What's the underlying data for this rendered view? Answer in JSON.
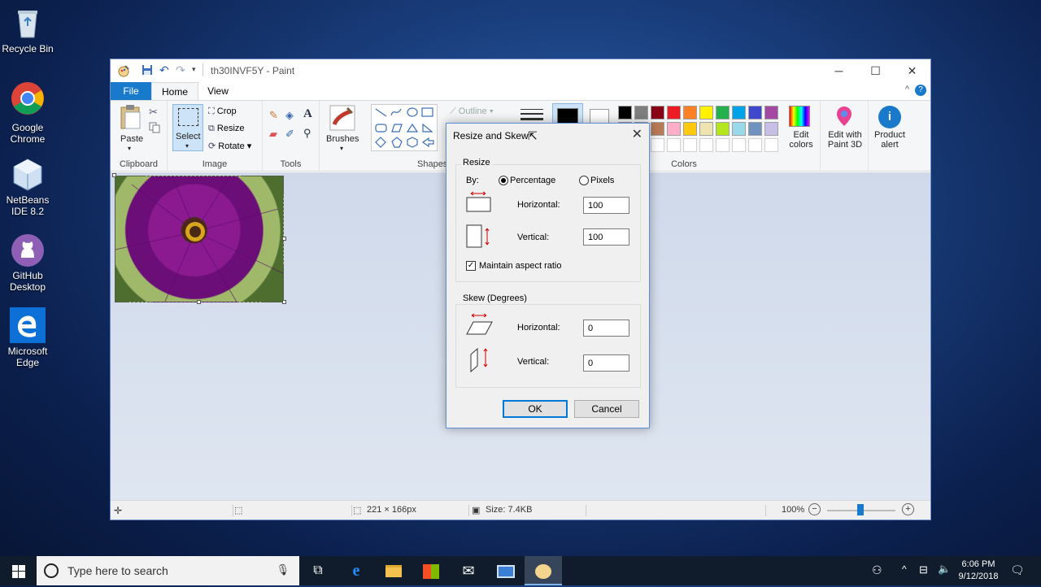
{
  "desktop": {
    "icons": [
      {
        "label": "Recycle Bin",
        "icon": "recycle-bin-icon"
      },
      {
        "label": "Google Chrome",
        "icon": "chrome-icon"
      },
      {
        "label": "NetBeans IDE 8.2",
        "icon": "netbeans-icon"
      },
      {
        "label": "GitHub Desktop",
        "icon": "github-icon"
      },
      {
        "label": "Microsoft Edge",
        "icon": "edge-icon"
      }
    ]
  },
  "paint": {
    "title": "th30INVF5Y - Paint",
    "tabs": {
      "file": "File",
      "home": "Home",
      "view": "View"
    },
    "ribbon": {
      "paste": "Paste",
      "clipboard": "Clipboard",
      "select": "Select",
      "crop": "Crop",
      "resize": "Resize",
      "rotate": "Rotate",
      "image": "Image",
      "tools": "Tools",
      "brushes": "Brushes",
      "shapes": "Shapes",
      "outline": "Outline",
      "colors": "Colors",
      "edit_colors": "Edit colors",
      "edit_with_3d": "Edit with Paint 3D",
      "product_alert": "Product alert"
    },
    "palette_row1": [
      "#000000",
      "#7f7f7f",
      "#880015",
      "#ed1c24",
      "#ff7f27",
      "#fff200",
      "#22b14c",
      "#00a2e8",
      "#3f48cc",
      "#a349a4"
    ],
    "palette_row2": [
      "#ffffff",
      "#c3c3c3",
      "#b97a57",
      "#ffaec9",
      "#ffc90e",
      "#efe4b0",
      "#b5e61d",
      "#99d9ea",
      "#7092be",
      "#c8bfe7"
    ],
    "status": {
      "dimensions": "221 × 166px",
      "size": "Size: 7.4KB",
      "zoom": "100%"
    }
  },
  "dialog": {
    "title": "Resize and Skew",
    "resize_label": "Resize",
    "by_label": "By:",
    "percentage_label": "Percentage",
    "pixels_label": "Pixels",
    "horizontal_label": "Horizontal:",
    "vertical_label": "Vertical:",
    "resize_horizontal": "100",
    "resize_vertical": "100",
    "maintain_label": "Maintain aspect ratio",
    "skew_label": "Skew (Degrees)",
    "skew_horizontal": "0",
    "skew_vertical": "0",
    "ok": "OK",
    "cancel": "Cancel"
  },
  "taskbar": {
    "search_placeholder": "Type here to search",
    "time": "6:06 PM",
    "date": "9/12/2018"
  }
}
